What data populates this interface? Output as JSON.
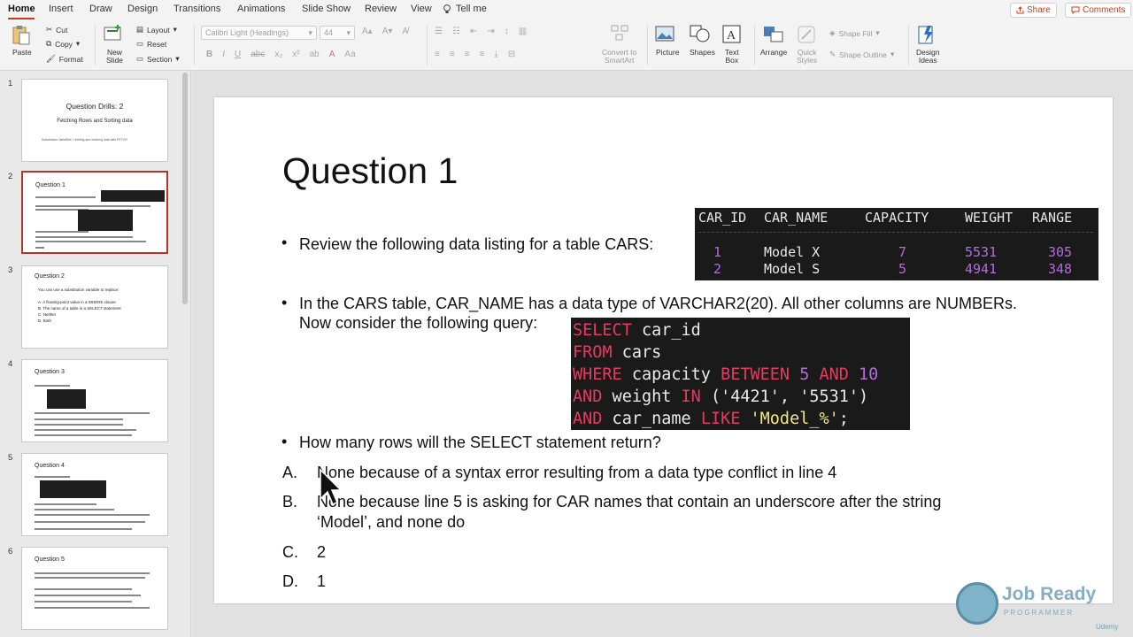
{
  "ribbon_tabs": [
    "Home",
    "Insert",
    "Draw",
    "Design",
    "Transitions",
    "Animations",
    "Slide Show",
    "Review",
    "View",
    "Tell me"
  ],
  "top_buttons": {
    "share": "Share",
    "comments": "Comments"
  },
  "ribbon": {
    "paste": "Paste",
    "cut": "Cut",
    "copy": "Copy",
    "format": "Format",
    "new_slide_1": "New",
    "new_slide_2": "Slide",
    "layout": "Layout",
    "reset": "Reset",
    "section": "Section",
    "font_name": "Calibri Light (Headings)",
    "font_size": "44",
    "convert_1": "Convert to",
    "convert_2": "SmartArt",
    "picture": "Picture",
    "shapes": "Shapes",
    "textbox_1": "Text",
    "textbox_2": "Box",
    "arrange": "Arrange",
    "quick_styles_1": "Quick",
    "quick_styles_2": "Styles",
    "shape_fill": "Shape Fill",
    "shape_outline": "Shape Outline",
    "design_ideas_1": "Design",
    "design_ideas_2": "Ideas"
  },
  "thumbnails": [
    {
      "num": "1",
      "title": "Question Drills: 2",
      "subtitle": "Fetching Rows and Sorting data",
      "note": "Substitution Variables + limiting and ordering data with FETCH"
    },
    {
      "num": "2",
      "title": "Question 1"
    },
    {
      "num": "3",
      "title": "Question 2",
      "line1": "You can use a substitution variable to replace:",
      "a": "A.  A floating-point value in a WHERE clause",
      "b": "B.  The name of a table in a SELECT statement",
      "c": "C.  Neither",
      "d": "D.  Both"
    },
    {
      "num": "4",
      "title": "Question 3"
    },
    {
      "num": "5",
      "title": "Question 4"
    },
    {
      "num": "6",
      "title": "Question 5"
    }
  ],
  "slide": {
    "title": "Question 1",
    "bullet1": "Review the following data listing for a table CARS:",
    "bullet2_line1": "In the CARS table, CAR_NAME has a data type of VARCHAR2(20). All other columns are NUMBERs.",
    "bullet2_line2": "Now consider the following query:",
    "bullet3": "How many rows will the SELECT statement return?",
    "options": [
      {
        "letter": "A.",
        "text": "None because of a syntax error resulting from a data type conflict in line 4"
      },
      {
        "letter": "B.",
        "text": "None because line 5 is asking for CAR names that contain an underscore after the string",
        "text2": "‘Model’, and none do"
      },
      {
        "letter": "C.",
        "text": "2"
      },
      {
        "letter": "D.",
        "text": "1"
      }
    ],
    "table": {
      "headers": [
        "CAR_ID",
        "CAR_NAME",
        "CAPACITY",
        "WEIGHT",
        "RANGE"
      ],
      "rows": [
        [
          "1",
          "Model X",
          "7",
          "5531",
          "305"
        ],
        [
          "2",
          "Model S",
          "5",
          "4941",
          "348"
        ]
      ]
    },
    "code": [
      [
        {
          "t": "SELECT",
          "c": "kw"
        },
        {
          "t": " car_id",
          "c": "id"
        }
      ],
      [
        {
          "t": "FROM",
          "c": "kw"
        },
        {
          "t": " cars",
          "c": "id"
        }
      ],
      [
        {
          "t": "WHERE",
          "c": "kw"
        },
        {
          "t": " capacity ",
          "c": "id"
        },
        {
          "t": "BETWEEN",
          "c": "kw"
        },
        {
          "t": " 5 ",
          "c": "num"
        },
        {
          "t": "AND",
          "c": "kw"
        },
        {
          "t": " 10",
          "c": "num"
        }
      ],
      [
        {
          "t": "AND",
          "c": "kw"
        },
        {
          "t": " weight ",
          "c": "id"
        },
        {
          "t": "IN",
          "c": "kw"
        },
        {
          "t": " ('4421', '5531')",
          "c": "id"
        }
      ],
      [
        {
          "t": "AND",
          "c": "kw"
        },
        {
          "t": " car_name ",
          "c": "id"
        },
        {
          "t": "LIKE",
          "c": "kw"
        },
        {
          "t": " 'Model_%'",
          "c": "str"
        },
        {
          "t": ";",
          "c": "id"
        }
      ]
    ]
  },
  "branding": {
    "logo_main": "Job Ready",
    "logo_sub": "PROGRAMMER",
    "udemy": "Udemy"
  },
  "colors": {
    "accent": "#c43e1c",
    "selected_border": "#b2352b",
    "keyword": "#e83a5c",
    "number": "#b46cd9",
    "string": "#f1e686"
  }
}
